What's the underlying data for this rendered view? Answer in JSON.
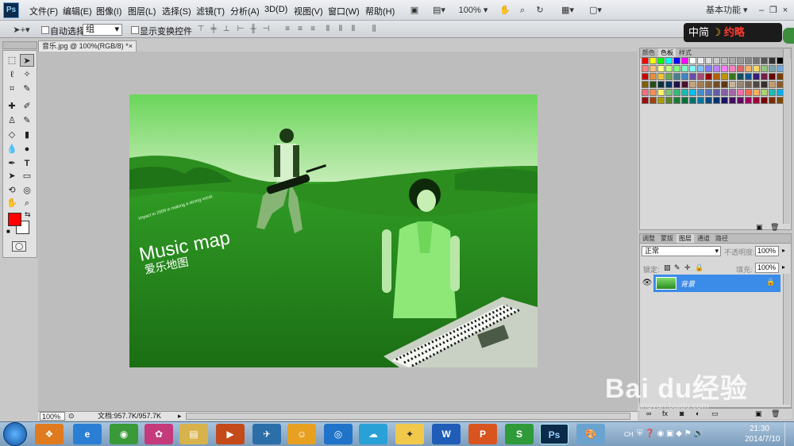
{
  "app": {
    "logo": "Ps"
  },
  "menu": [
    "文件(F)",
    "编辑(E)",
    "图像(I)",
    "图层(L)",
    "选择(S)",
    "滤镜(T)",
    "分析(A)",
    "3D(D)",
    "视图(V)",
    "窗口(W)",
    "帮助(H)"
  ],
  "toolbar": {
    "zoom": "100%",
    "workspace": "基本功能",
    "window_min": "–",
    "window_restore": "❐",
    "window_close": "×"
  },
  "options": {
    "auto_select_label": "自动选择:",
    "auto_select_value": "组",
    "show_transform_label": "显示变换控件"
  },
  "overlay": {
    "ime_text": "中简",
    "ime_brand": "约略"
  },
  "document": {
    "tab_title": "音乐.jpg @ 100%(RGB/8) *",
    "tab_close": "×",
    "zoom": "100%",
    "doc_info": "文档:957.7K/957.7K"
  },
  "image": {
    "caption_line": "Impact in 2009 is making a strong vocal.",
    "title_en": "Music map",
    "title_cn": "爱乐地图"
  },
  "panels": {
    "top_tabs": [
      "颜色",
      "色板",
      "样式"
    ],
    "layers_tabs": [
      "调整",
      "蒙版",
      "图层",
      "通道",
      "路径"
    ],
    "blend_mode": "正常",
    "opacity_label": "不透明度:",
    "opacity_value": "100%",
    "lock_label": "锁定:",
    "fill_label": "填充:",
    "fill_value": "100%",
    "layer_name": "背景"
  },
  "taskbar": {
    "time": "21:30",
    "date": "2014/7/10",
    "lang": "CH"
  },
  "watermark": {
    "brand": "Bai du经验",
    "url": "jingyan.baidu.com"
  },
  "colors": {
    "accent": "#3b8be8",
    "fg": "#ff0000",
    "bg": "#ffffff"
  }
}
